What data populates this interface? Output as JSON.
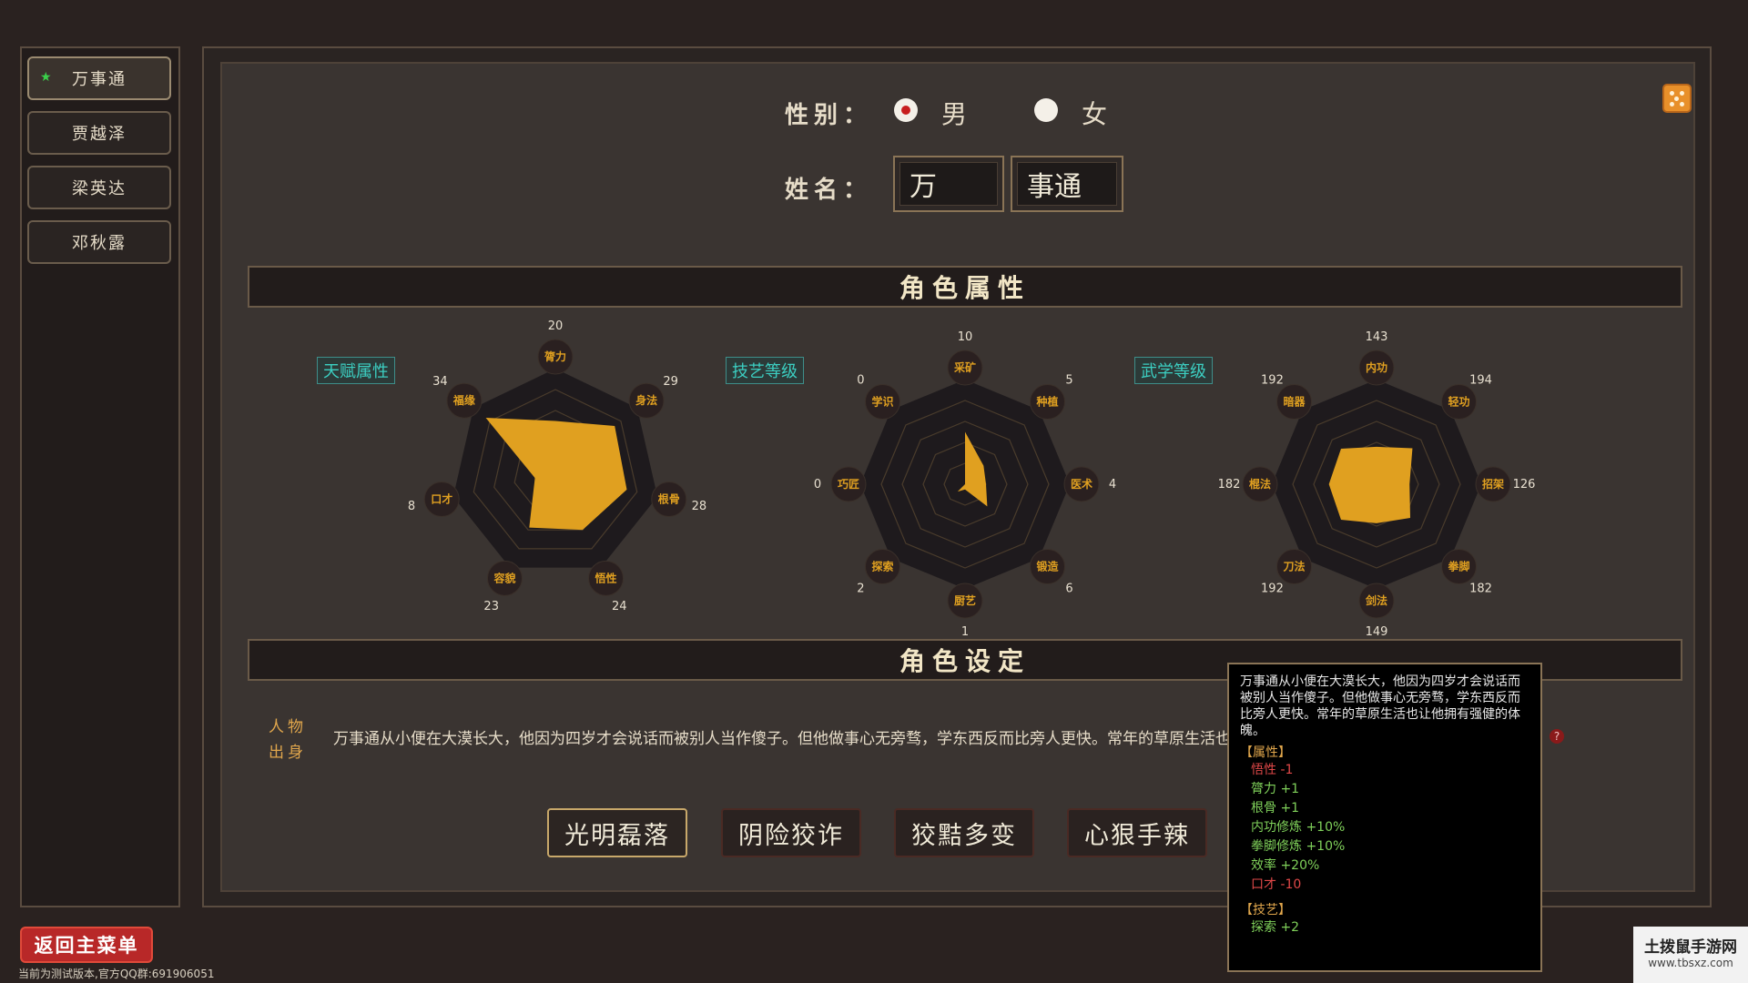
{
  "sidebar": {
    "items": [
      {
        "label": "万事通",
        "active": true
      },
      {
        "label": "贾越泽",
        "active": false
      },
      {
        "label": "梁英达",
        "active": false
      },
      {
        "label": "邓秋露",
        "active": false
      }
    ]
  },
  "form": {
    "gender_label": "性别：",
    "gender_options": [
      {
        "label": "男",
        "selected": true
      },
      {
        "label": "女",
        "selected": false
      }
    ],
    "name_label": "姓名：",
    "surname": "万",
    "given_name": "事通"
  },
  "sections": {
    "attributes_title": "角色属性",
    "settings_title": "角色设定"
  },
  "colors": {
    "accent_gold": "#e0a020",
    "radar_dark": "#1e1a1d",
    "tag_teal": "#3ccfc2",
    "negative_red": "#e04848",
    "positive_green": "#7fd05a"
  },
  "chart_data": [
    {
      "type": "radar",
      "title": "天赋属性",
      "categories": [
        "膂力",
        "身法",
        "根骨",
        "悟性",
        "容貌",
        "口才",
        "福缘"
      ],
      "values": [
        20,
        29,
        28,
        24,
        23,
        8,
        34
      ],
      "max": 40,
      "fill_color": "#e0a020"
    },
    {
      "type": "radar",
      "title": "技艺等级",
      "categories": [
        "采矿",
        "种植",
        "医术",
        "锻造",
        "厨艺",
        "探索",
        "巧匠",
        "学识"
      ],
      "values": [
        10,
        5,
        4,
        6,
        1,
        2,
        0,
        0
      ],
      "max": 20,
      "fill_color": "#e0a020"
    },
    {
      "type": "radar",
      "title": "武学等级",
      "categories": [
        "内功",
        "轻功",
        "招架",
        "拳脚",
        "剑法",
        "刀法",
        "棍法",
        "暗器"
      ],
      "values": [
        143,
        194,
        126,
        182,
        149,
        192,
        182,
        192
      ],
      "max": 400,
      "fill_color": "#e0a020"
    }
  ],
  "bio": {
    "label_line1": "人物",
    "label_line2": "出身",
    "text": "万事通从小便在大漠长大，他因为四岁才会说话而被别人当作傻子。但他做事心无旁骛，学东西反而比旁人更快。常年的草原生活也让他拥有强健的体魄。",
    "help_icon": "?"
  },
  "traits": [
    {
      "label": "光明磊落",
      "active": true
    },
    {
      "label": "阴险狡诈",
      "active": false
    },
    {
      "label": "狡黠多变",
      "active": false
    },
    {
      "label": "心狠手辣",
      "active": false
    }
  ],
  "tooltip": {
    "description": "万事通从小便在大漠长大，他因为四岁才会说话而被别人当作傻子。但他做事心无旁骛，学东西反而比旁人更快。常年的草原生活也让他拥有强健的体魄。",
    "attr_header": "【属性】",
    "attr_rows": [
      {
        "text": "悟性 -1",
        "negative": true
      },
      {
        "text": "膂力 +1",
        "negative": false
      },
      {
        "text": "根骨 +1",
        "negative": false
      },
      {
        "text": "内功修炼 +10%",
        "negative": false
      },
      {
        "text": "拳脚修炼 +10%",
        "negative": false
      },
      {
        "text": "效率 +20%",
        "negative": false
      },
      {
        "text": "口才 -10",
        "negative": true
      }
    ],
    "skill_header": "【技艺】",
    "skill_rows": [
      {
        "text": "探索 +2",
        "negative": false
      }
    ]
  },
  "icons": {
    "dice": "dice-icon",
    "star": "star-icon"
  },
  "footer": {
    "back_button": "返回主菜单",
    "version_note": "当前为测试版本,官方QQ群:691906051",
    "watermark_title": "土拨鼠手游网",
    "watermark_url": "www.tbsxz.com"
  }
}
